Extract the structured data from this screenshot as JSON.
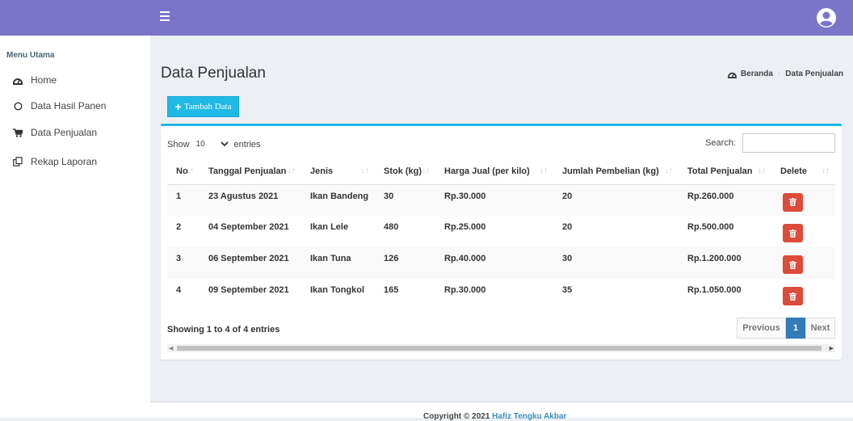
{
  "sidebar": {
    "header": "Menu Utama",
    "items": [
      {
        "label": "Home",
        "icon": "dashboard-icon"
      },
      {
        "label": "Data Hasil Panen",
        "icon": "circle-icon"
      },
      {
        "label": "Data Penjualan",
        "icon": "cart-icon"
      },
      {
        "label": "Rekap Laporan",
        "icon": "copy-icon"
      }
    ]
  },
  "page": {
    "title": "Data Penjualan",
    "breadcrumb": [
      "Beranda",
      "Data Penjualan"
    ],
    "add_button": "Tambah Data"
  },
  "table_controls": {
    "show_label": "Show",
    "entries_value": "10",
    "entries_label": "entries",
    "search_label": "Search:",
    "search_value": ""
  },
  "table": {
    "columns": [
      "No",
      "Tanggal Penjualan",
      "Jenis",
      "Stok (kg)",
      "Harga Jual (per kilo)",
      "Jumlah Pembelian (kg)",
      "Total Penjualan",
      "Delete"
    ],
    "rows": [
      [
        "1",
        "23 Agustus 2021",
        "Ikan Bandeng",
        "30",
        "Rp.30.000",
        "20",
        "Rp.260.000"
      ],
      [
        "2",
        "04 September 2021",
        "Ikan Lele",
        "480",
        "Rp.25.000",
        "20",
        "Rp.500.000"
      ],
      [
        "3",
        "06 September 2021",
        "Ikan Tuna",
        "126",
        "Rp.40.000",
        "30",
        "Rp.1.200.000"
      ],
      [
        "4",
        "09 September 2021",
        "Ikan Tongkol",
        "165",
        "Rp.30.000",
        "35",
        "Rp.1.050.000"
      ]
    ]
  },
  "pagination": {
    "info": "Showing 1 to 4 of 4 entries",
    "previous": "Previous",
    "current": "1",
    "next": "Next"
  },
  "footer": {
    "text": "Copyright © 2021",
    "link": "Hafiz Tengku Akbar"
  },
  "colors": {
    "topbar": "#7b74c9",
    "accent": "#21b8e6",
    "danger": "#dd4b39",
    "page_active": "#337ab7"
  }
}
